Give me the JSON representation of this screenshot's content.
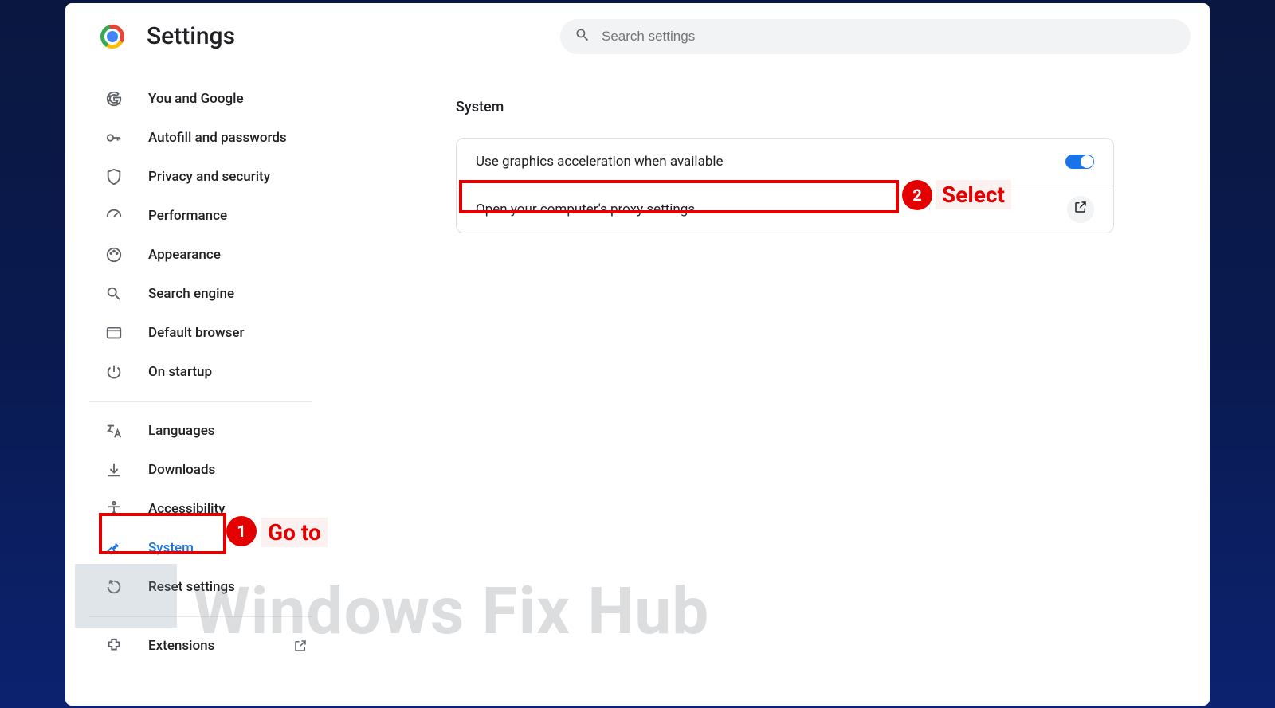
{
  "header": {
    "title": "Settings",
    "search_placeholder": "Search settings"
  },
  "sidebar": {
    "items": [
      {
        "id": "you-and-google",
        "label": "You and Google",
        "icon": "google"
      },
      {
        "id": "autofill",
        "label": "Autofill and passwords",
        "icon": "key"
      },
      {
        "id": "privacy",
        "label": "Privacy and security",
        "icon": "shield"
      },
      {
        "id": "performance",
        "label": "Performance",
        "icon": "speed"
      },
      {
        "id": "appearance",
        "label": "Appearance",
        "icon": "palette"
      },
      {
        "id": "search-engine",
        "label": "Search engine",
        "icon": "search"
      },
      {
        "id": "default-browser",
        "label": "Default browser",
        "icon": "browser"
      },
      {
        "id": "on-startup",
        "label": "On startup",
        "icon": "power"
      },
      {
        "id": "languages",
        "label": "Languages",
        "icon": "translate"
      },
      {
        "id": "downloads",
        "label": "Downloads",
        "icon": "download"
      },
      {
        "id": "accessibility",
        "label": "Accessibility",
        "icon": "accessibility"
      },
      {
        "id": "system",
        "label": "System",
        "icon": "wrench",
        "active": true
      },
      {
        "id": "reset",
        "label": "Reset settings",
        "icon": "reset"
      },
      {
        "id": "extensions",
        "label": "Extensions",
        "icon": "extension",
        "external": true
      }
    ]
  },
  "main": {
    "section_title": "System",
    "rows": [
      {
        "label": "Use graphics acceleration when available",
        "control": "toggle",
        "toggle_on": true
      },
      {
        "label": "Open your computer's proxy settings",
        "control": "launch"
      }
    ]
  },
  "annotations": {
    "step1": {
      "num": "1",
      "text": "Go to"
    },
    "step2": {
      "num": "2",
      "text": "Select"
    }
  },
  "watermark": "Windows Fix Hub"
}
